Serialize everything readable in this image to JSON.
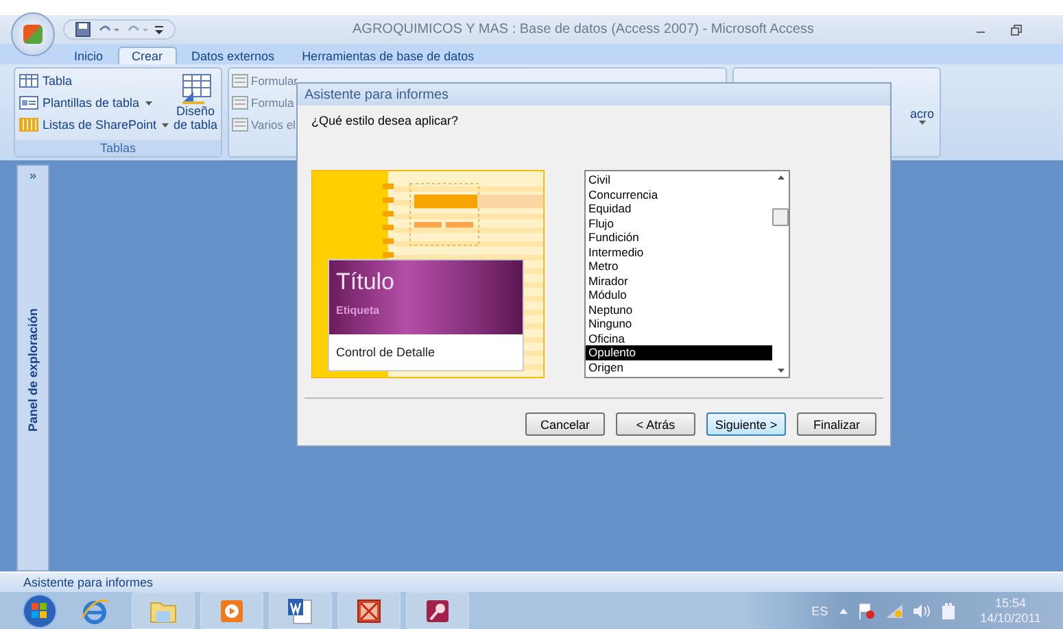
{
  "window": {
    "title": "AGROQUIMICOS Y MAS : Base de datos (Access 2007) - Microsoft Access"
  },
  "ribbon": {
    "tabs": [
      {
        "label": "Inicio",
        "selected": false
      },
      {
        "label": "Crear",
        "selected": true
      },
      {
        "label": "Datos externos",
        "selected": false
      },
      {
        "label": "Herramientas de base de datos",
        "selected": false
      }
    ],
    "tables_group": {
      "label": "Tablas",
      "commands": [
        {
          "kind": "table",
          "label": "Tabla",
          "dropdown": false
        },
        {
          "kind": "template",
          "label": "Plantillas de tabla",
          "dropdown": true
        },
        {
          "kind": "sharepoint",
          "label": "Listas de SharePoint",
          "dropdown": true
        }
      ],
      "big_button": "Diseño de tabla"
    },
    "forms_group": {
      "commands": [
        "Formular",
        "Formula",
        "Varios el"
      ]
    },
    "macro_group": {
      "label": "acro"
    }
  },
  "nav_pane": {
    "toggle": "»",
    "title": "Panel de exploración"
  },
  "dialog": {
    "title": "Asistente para informes",
    "question": "¿Qué estilo desea aplicar?",
    "preview": {
      "title": "Título",
      "label": "Etiqueta",
      "detail": "Control de Detalle"
    },
    "styles": [
      {
        "label": "Civil",
        "selected": false
      },
      {
        "label": "Concurrencia",
        "selected": false
      },
      {
        "label": "Equidad",
        "selected": false
      },
      {
        "label": "Flujo",
        "selected": false
      },
      {
        "label": "Fundición",
        "selected": false
      },
      {
        "label": "Intermedio",
        "selected": false
      },
      {
        "label": "Metro",
        "selected": false
      },
      {
        "label": "Mirador",
        "selected": false
      },
      {
        "label": "Módulo",
        "selected": false
      },
      {
        "label": "Neptuno",
        "selected": false
      },
      {
        "label": "Ninguno",
        "selected": false
      },
      {
        "label": "Oficina",
        "selected": false
      },
      {
        "label": "Opulento",
        "selected": true
      },
      {
        "label": "Origen",
        "selected": false
      }
    ],
    "buttons": [
      {
        "label": "Cancelar",
        "default": false
      },
      {
        "label": "< Atrás",
        "default": false
      },
      {
        "label": "Siguiente >",
        "default": true
      },
      {
        "label": "Finalizar",
        "default": false
      }
    ]
  },
  "status_bar": "Asistente para informes",
  "taskbar": {
    "apps": [
      {
        "kind": "ie"
      },
      {
        "kind": "folder"
      },
      {
        "kind": "media"
      },
      {
        "kind": "word"
      },
      {
        "kind": "powerpoint"
      },
      {
        "kind": "access"
      }
    ],
    "tray": {
      "language": "ES",
      "time": "15:54",
      "date": "14/10/2011"
    }
  }
}
